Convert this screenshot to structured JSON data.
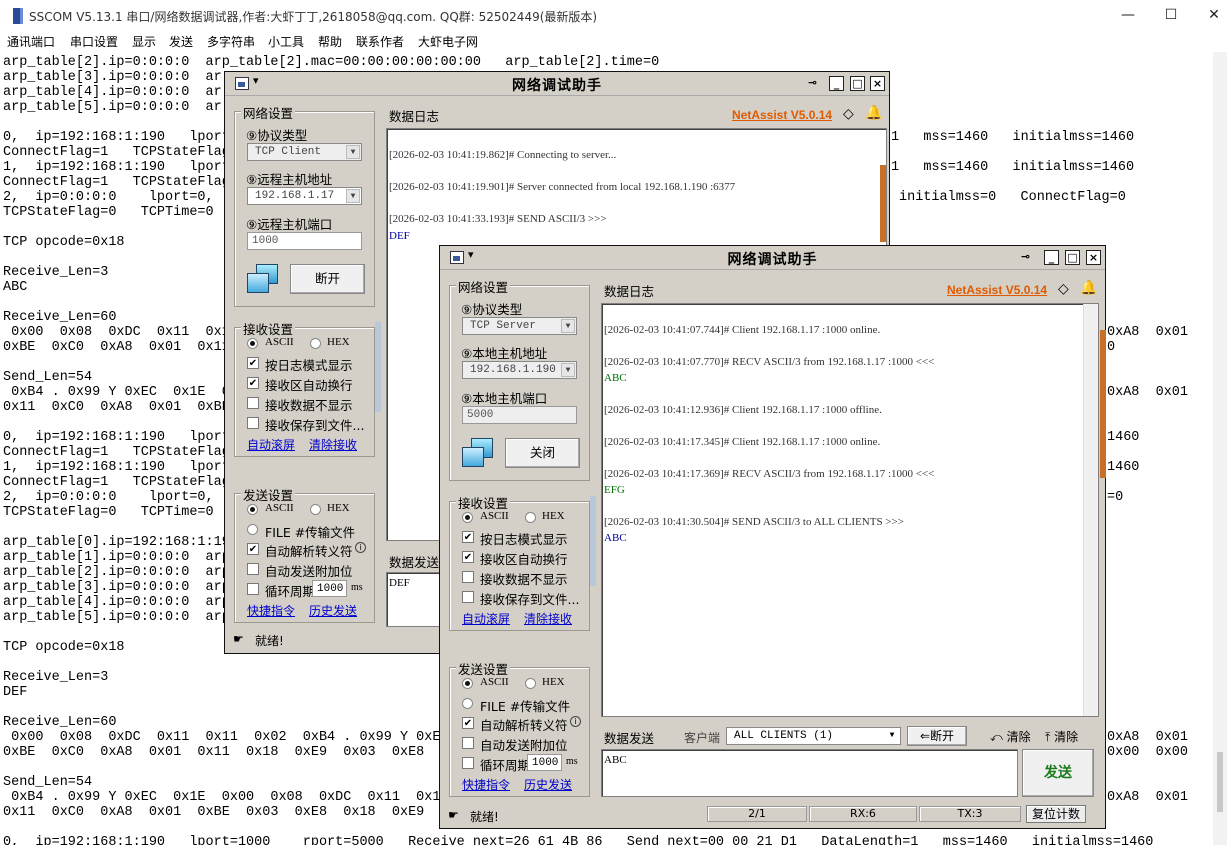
{
  "sscom": {
    "title": "SSCOM V5.13.1 串口/网络数据调试器,作者:大虾丁丁,2618058@qq.com. QQ群: 52502449(最新版本)",
    "menu": [
      "通讯端口",
      "串口设置",
      "显示",
      "发送",
      "多字符串",
      "小工具",
      "帮助",
      "联系作者",
      "大虾电子网"
    ],
    "terminal_left": [
      "arp_table[2].ip=0:0:0:0  arp_table[2].mac=00:00:00:00:00:00   arp_table[2].time=0",
      "arp_table[3].ip=0:0:0:0  ar",
      "arp_table[4].ip=0:0:0:0  ar",
      "arp_table[5].ip=0:0:0:0  ar",
      "",
      "0,  ip=192:168:1:190   lport",
      "ConnectFlag=1   TCPStateFlag",
      "1,  ip=192:168:1:190   lport",
      "ConnectFlag=1   TCPStateFlag",
      "2,  ip=0:0:0:0    lport=0,",
      "TCPStateFlag=0   TCPTime=0",
      "",
      "TCP opcode=0x18",
      "",
      "Receive_Len=3",
      "ABC",
      "",
      "Receive_Len=60",
      " 0x00  0x08  0xDC  0x11  0x1",
      "0xBE  0xC0  0xA8  0x01  0x11",
      "",
      "Send_Len=54",
      " 0xB4 . 0x99 Y 0xEC  0x1E  0",
      "0x11  0xC0  0xA8  0x01  0xBE",
      "",
      "0,  ip=192:168:1:190   lport",
      "ConnectFlag=1   TCPStateFlag",
      "1,  ip=192:168:1:190   lport",
      "ConnectFlag=1   TCPStateFlag",
      "2,  ip=0:0:0:0    lport=0,",
      "TCPStateFlag=0   TCPTime=0",
      "",
      "arp_table[0].ip=192:168:1:19",
      "arp_table[1].ip=0:0:0:0  arp",
      "arp_table[2].ip=0:0:0:0  arp",
      "arp_table[3].ip=0:0:0:0  arp",
      "arp_table[4].ip=0:0:0:0  arp",
      "arp_table[5].ip=0:0:0:0  arp",
      "",
      "TCP opcode=0x18",
      "",
      "Receive_Len=3",
      "DEF",
      "",
      "Receive_Len=60",
      " 0x00  0x08  0xDC  0x11  0x11  0x02  0xB4 . 0x99 Y 0xEC",
      "0xBE  0xC0  0xA8  0x01  0x11  0x18  0xE9  0x03  0xE8",
      "",
      "Send_Len=54",
      " 0xB4 . 0x99 Y 0xEC  0x1E  0x00  0x08  0xDC  0x11  0x11",
      "0x11  0xC0  0xA8  0x01  0xBE  0x03  0xE8  0x18  0xE9",
      "",
      "0,  ip=192:168:1:190   lport=1000    rport=5000   Receive_next=26 61 4B 86   Send_next=00 00 21 D1   DataLength=1   mss=1460   initialmss=1460"
    ],
    "terminal_right": [
      {
        "row": 5,
        "text": "1   mss=1460   initialmss=1460"
      },
      {
        "row": 7,
        "text": "1   mss=1460   initialmss=1460"
      },
      {
        "row": 9,
        "text": "initialmss=0   ConnectFlag=0"
      },
      {
        "row": 18,
        "text": "0xA8  0x01"
      },
      {
        "row": 19,
        "text": "0"
      },
      {
        "row": 22,
        "text": "0xA8  0x01"
      },
      {
        "row": 25,
        "text": "1460"
      },
      {
        "row": 27,
        "text": "1460"
      },
      {
        "row": 29,
        "text": "=0"
      },
      {
        "row": 45,
        "text": "0xA8  0x01"
      },
      {
        "row": 46,
        "text": "0x00  0x00"
      },
      {
        "row": 49,
        "text": "0xA8  0x01"
      }
    ]
  },
  "client": {
    "title": "网络调试助手",
    "brand": "NetAssist V5.0.14",
    "net_group": "网络设置",
    "protocol_label": "⑨协议类型",
    "protocol_value": "TCP Client",
    "host_label": "⑨远程主机地址",
    "host_value": "192.168.1.17",
    "port_label": "⑨远程主机端口",
    "port_value": "1000",
    "connect_btn": "断开",
    "recv_group": "接收设置",
    "recv_ascii": "ASCII",
    "recv_hex": "HEX",
    "recv_opts": [
      "按日志模式显示",
      "接收区自动换行",
      "接收数据不显示",
      "接收保存到文件..."
    ],
    "recv_checked": [
      true,
      true,
      false,
      false
    ],
    "auto_scroll": "自动滚屏",
    "clear_recv": "清除接收",
    "send_group": "发送设置",
    "send_ascii": "ASCII",
    "send_hex": "HEX",
    "send_file": "FILE #传输文件",
    "send_opts": [
      "自动解析转义符",
      "自动发送附加位",
      "循环周期"
    ],
    "send_checked": [
      true,
      false,
      false
    ],
    "period_value": "1000",
    "period_unit": "ms",
    "quick_cmd": "快捷指令",
    "history_send": "历史发送",
    "log_tab": "数据日志",
    "send_tab": "数据发送",
    "send_text": "DEF",
    "status": "就绪!",
    "log": [
      {
        "text": "[2026-02-03 10:41:19.862]# Connecting to server...",
        "c": ""
      },
      {
        "text": "[2026-02-03 10:41:19.901]# Server connected from local 192.168.1.190 :6377",
        "c": ""
      },
      {
        "text": "[2026-02-03 10:41:33.193]# SEND ASCII/3 >>>",
        "c": ""
      },
      {
        "text": "DEF",
        "c": "b"
      }
    ]
  },
  "server": {
    "title": "网络调试助手",
    "brand": "NetAssist V5.0.14",
    "net_group": "网络设置",
    "protocol_label": "⑨协议类型",
    "protocol_value": "TCP Server",
    "host_label": "⑨本地主机地址",
    "host_value": "192.168.1.190",
    "port_label": "⑨本地主机端口",
    "port_value": "5000",
    "connect_btn": "关闭",
    "recv_group": "接收设置",
    "recv_ascii": "ASCII",
    "recv_hex": "HEX",
    "recv_opts": [
      "按日志模式显示",
      "接收区自动换行",
      "接收数据不显示",
      "接收保存到文件..."
    ],
    "recv_checked": [
      true,
      true,
      false,
      false
    ],
    "auto_scroll": "自动滚屏",
    "clear_recv": "清除接收",
    "send_group": "发送设置",
    "send_ascii": "ASCII",
    "send_hex": "HEX",
    "send_file": "FILE #传输文件",
    "send_opts": [
      "自动解析转义符",
      "自动发送附加位",
      "循环周期"
    ],
    "send_checked": [
      true,
      false,
      false
    ],
    "period_value": "1000",
    "period_unit": "ms",
    "quick_cmd": "快捷指令",
    "history_send": "历史发送",
    "log_tab": "数据日志",
    "send_tab": "数据发送",
    "client_label": "客户端",
    "client_value": "ALL CLIENTS (1)",
    "disconnect_btn": "断开",
    "clear1": "清除",
    "clear2": "清除",
    "send_text": "ABC",
    "send_btn": "发送",
    "status": "就绪!",
    "counter": "2/1",
    "rx": "RX:6",
    "tx": "TX:3",
    "reset": "复位计数",
    "log": [
      {
        "text": "[2026-02-03 10:41:07.744]# Client 192.168.1.17 :1000 online.",
        "c": ""
      },
      {
        "text": "[2026-02-03 10:41:07.770]# RECV ASCII/3 from 192.168.1.17 :1000 <<<",
        "c": ""
      },
      {
        "text": "ABC",
        "c": "g"
      },
      {
        "text": "[2026-02-03 10:41:12.936]# Client 192.168.1.17 :1000 offline.",
        "c": ""
      },
      {
        "text": "[2026-02-03 10:41:17.345]# Client 192.168.1.17 :1000 online.",
        "c": ""
      },
      {
        "text": "[2026-02-03 10:41:17.369]# RECV ASCII/3 from 192.168.1.17 :1000 <<<",
        "c": ""
      },
      {
        "text": "EFG",
        "c": "g"
      },
      {
        "text": "[2026-02-03 10:41:30.504]# SEND ASCII/3 to ALL CLIENTS >>>",
        "c": ""
      },
      {
        "text": "ABC",
        "c": "b"
      }
    ]
  }
}
